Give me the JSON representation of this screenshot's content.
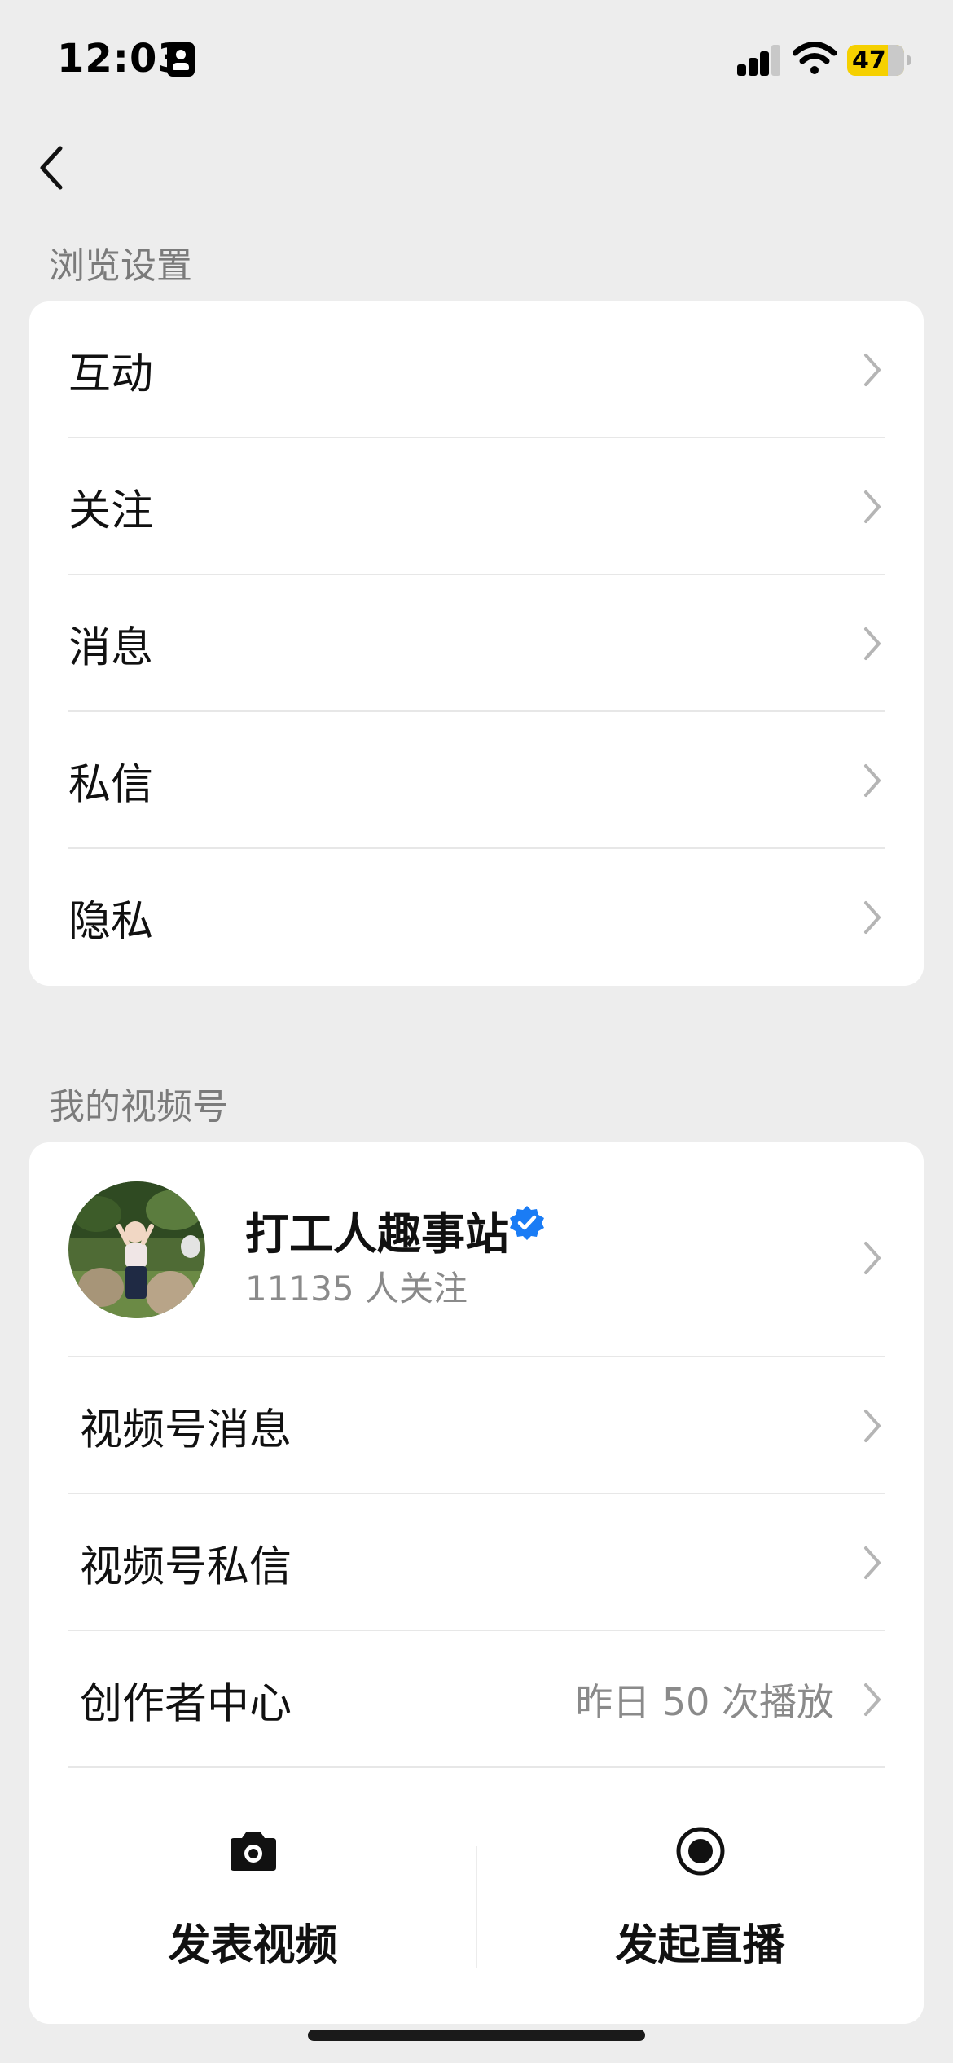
{
  "status_bar": {
    "time": "12:03",
    "battery": "47"
  },
  "browse_settings": {
    "title": "浏览设置",
    "items": [
      {
        "label": "互动"
      },
      {
        "label": "关注"
      },
      {
        "label": "消息"
      },
      {
        "label": "私信"
      },
      {
        "label": "隐私"
      }
    ]
  },
  "channel": {
    "title": "我的视频号",
    "profile": {
      "name": "打工人趣事站",
      "followers": "11135 人关注"
    },
    "items": [
      {
        "label": "视频号消息",
        "sub": ""
      },
      {
        "label": "视频号私信",
        "sub": ""
      },
      {
        "label": "创作者中心",
        "sub": "昨日 50 次播放"
      }
    ],
    "actions": [
      {
        "label": "发表视频",
        "icon": "camera-icon"
      },
      {
        "label": "发起直播",
        "icon": "live-icon"
      }
    ]
  },
  "colors": {
    "background": "#ededed",
    "card": "#ffffff",
    "verified": "#1a7cf5",
    "battery": "#f5d000"
  }
}
